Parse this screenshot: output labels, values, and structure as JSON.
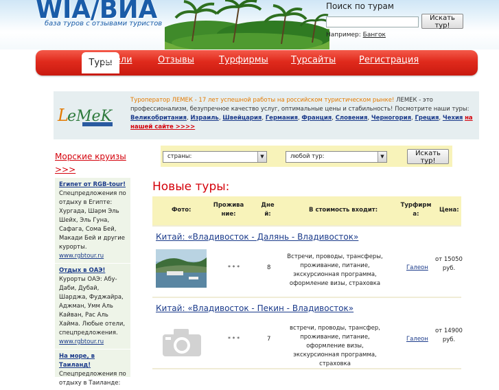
{
  "header": {
    "logo": "WIA/ВИА",
    "tagline": "база туров с отзывами туристов",
    "search": {
      "title": "Поиск по турам",
      "input_value": "",
      "button": "Искать тур!",
      "example_label": "Например: ",
      "example_link": "Бангок"
    }
  },
  "nav": {
    "active": "Туры",
    "tabs": [
      "Отели",
      "Отзывы",
      "Турфирмы",
      "Турсайты",
      "Регистрация"
    ]
  },
  "ad": {
    "logo": "LEMEK",
    "lead": "Туроператор ЛЕМЕК - 17 лет успешной работы на российском туристическом рынке!",
    "body": " ЛЕМЕК - это профессионализм, безупречное качество услуг, оптимальные цены и стабильность! Посмотрите наши туры: ",
    "links": [
      "Великобритания",
      "Израиль",
      "Швейцария",
      "Германия",
      "Франция",
      "Словения",
      "Черногория",
      "Греция",
      "Чехия"
    ],
    "more": "на нашей сайте >>>>"
  },
  "sidebar": {
    "sea_link": "Морские круизы >>>",
    "items": [
      {
        "title": "Египет от RGB-tour!",
        "text": "Спецпредложения по отдыху в Египте: Хургада, Шарм Эль Шейх, Эль Гуна, Сафага, Сома Бей, Макади Бей и другие курорты.",
        "site": "www.rgbtour.ru"
      },
      {
        "title": "Отдых в ОАЭ!",
        "text": "Курорты ОАЭ: Абу-Даби, Дубай, Шарджа, Фуджайра, Аджман, Умм Аль Кайван, Рас Аль Хайма. Любые отели, спецпредложения.",
        "site": "www.rgbtour.ru"
      },
      {
        "title": "На море, в Таиланд!",
        "text": "Спецпредложения по отдыху в Таиланде:",
        "site": ""
      }
    ]
  },
  "filter": {
    "country": "страны:",
    "tour": "любой тур:",
    "button": "Искать тур!"
  },
  "tours": {
    "heading": "Новые туры:",
    "columns": [
      "Фото:",
      "Проживание:",
      "Дней:",
      "В стоимость входит:",
      "Турфирма:",
      "Цена:"
    ],
    "rows": [
      {
        "country": "Китай",
        "route": "«Владивосток - Далянь - Владивосток»",
        "stars": "* * *",
        "days": "8",
        "includes": "Встречи, проводы, трансферы, проживание, питание, экскурсионная программа, оформление визы, страховка",
        "firm": "Галеон",
        "price": "от 15050 руб."
      },
      {
        "country": "Китай",
        "route": "«Владивосток - Пекин - Владивосток»",
        "stars": "* * *",
        "days": "7",
        "includes": "встречи, проводы, трансфер, проживание, питание, оформление визы, экскурсионная программа, страховка",
        "firm": "Галеон",
        "price": "от 14900 руб."
      }
    ]
  },
  "colors": {
    "brand_blue": "#1a5ca8",
    "nav_red": "#e02a1c",
    "accent_red": "#d4000a",
    "table_header": "#f8f3ba",
    "sidebar_bg": "#eef4e8"
  }
}
